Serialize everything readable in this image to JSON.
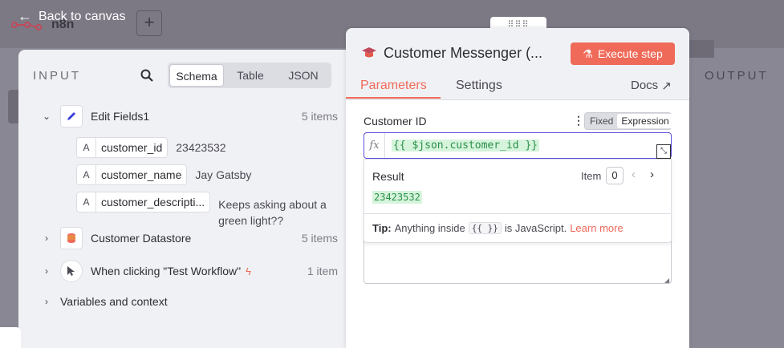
{
  "canvas": {
    "back_label": "Back to canvas",
    "logo_text": "n8n",
    "add_label": "+",
    "output_label": "OUTPUT"
  },
  "input": {
    "label": "INPUT",
    "view_tabs": [
      "Schema",
      "Table",
      "JSON"
    ],
    "active_tab": "Schema",
    "nodes": [
      {
        "name": "Edit Fields1",
        "count": "5 items",
        "expanded": true,
        "icon": "pencil-icon"
      },
      {
        "name": "Customer Datastore",
        "count": "5 items",
        "expanded": false,
        "icon": "database-icon"
      },
      {
        "name": "When clicking \"Test Workflow\"",
        "count": "1 item",
        "expanded": false,
        "icon": "cursor-icon"
      }
    ],
    "fields": [
      {
        "type": "A",
        "name": "customer_id",
        "value": "23423532"
      },
      {
        "type": "A",
        "name": "customer_name",
        "value": "Jay Gatsby"
      },
      {
        "type": "A",
        "name": "customer_descripti...",
        "value": "Keeps asking about a green light??"
      }
    ],
    "variables_label": "Variables and context"
  },
  "modal": {
    "title": "Customer Messenger (...",
    "execute_label": "Execute step",
    "tabs": [
      "Parameters",
      "Settings"
    ],
    "active_tab": "Parameters",
    "docs_label": "Docs",
    "accent": "#ef6a59",
    "param": {
      "label": "Customer ID",
      "mode_options": [
        "Fixed",
        "Expression"
      ],
      "mode_selected": "Expression",
      "fx": "fx",
      "expression": "{{ $json.customer_id }}"
    },
    "result": {
      "label": "Result",
      "item_label": "Item",
      "item_index": "0",
      "value": "23423532",
      "tip_bold": "Tip:",
      "tip_text": "Anything inside",
      "tip_code": "{{ }}",
      "tip_text2": "is JavaScript.",
      "tip_link": "Learn more"
    }
  }
}
